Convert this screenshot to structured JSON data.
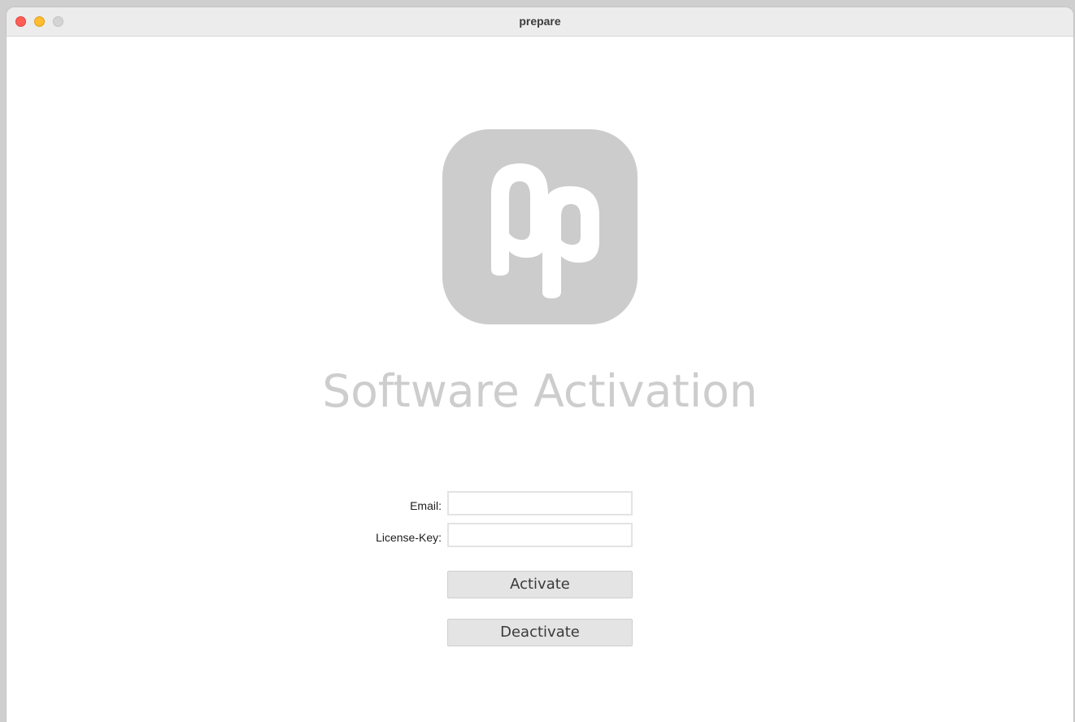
{
  "window": {
    "title": "prepare"
  },
  "logo": {
    "icon": "prepare-app-logo",
    "color": "#cccccc"
  },
  "heading": "Software Activation",
  "form": {
    "email_label": "Email:",
    "email_value": "",
    "license_label": "License-Key:",
    "license_value": "",
    "activate_label": "Activate",
    "deactivate_label": "Deactivate"
  }
}
